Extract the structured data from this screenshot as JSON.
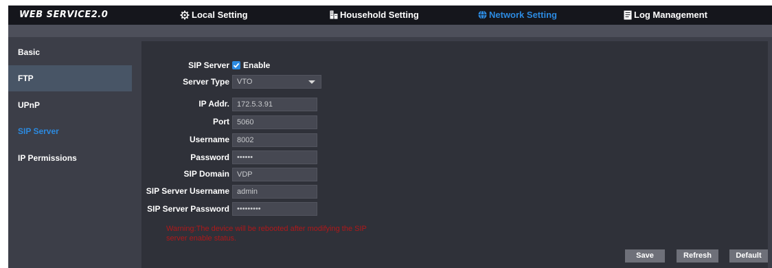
{
  "app": {
    "logo": "WEB SERVICE2.0"
  },
  "nav": {
    "items": [
      {
        "label": "Local Setting",
        "icon": "gear-icon"
      },
      {
        "label": "Household Setting",
        "icon": "building-icon"
      },
      {
        "label": "Network Setting",
        "icon": "globe-icon",
        "active": true
      },
      {
        "label": "Log Management",
        "icon": "log-icon"
      }
    ],
    "active_color": "#2c8ae0"
  },
  "sidebar": {
    "items": [
      {
        "label": "Basic"
      },
      {
        "label": "FTP",
        "selected": true
      },
      {
        "label": "UPnP"
      },
      {
        "label": "SIP Server",
        "current": true
      },
      {
        "label": "IP Permissions"
      }
    ]
  },
  "form": {
    "sip_server": {
      "label": "SIP Server",
      "checkbox_label": "Enable",
      "checked": true
    },
    "server_type": {
      "label": "Server Type",
      "value": "VTO"
    },
    "ip_addr": {
      "label": "IP Addr.",
      "value": "172.5.3.91"
    },
    "port": {
      "label": "Port",
      "value": "5060"
    },
    "username": {
      "label": "Username",
      "value": "8002"
    },
    "password": {
      "label": "Password",
      "value": "••••••"
    },
    "sip_domain": {
      "label": "SIP Domain",
      "value": "VDP"
    },
    "sip_server_username": {
      "label": "SIP Server Username",
      "value": "admin"
    },
    "sip_server_password": {
      "label": "SIP Server Password",
      "value": "•••••••••"
    },
    "warning": "Warning:The device will be rebooted after modifying the SIP server enable status."
  },
  "buttons": {
    "save": "Save",
    "refresh": "Refresh",
    "default": "Default"
  },
  "colors": {
    "header_bg": "#15161c",
    "content_bg": "#2f3139",
    "warning": "#b0181a",
    "accent": "#2c8ae0"
  }
}
